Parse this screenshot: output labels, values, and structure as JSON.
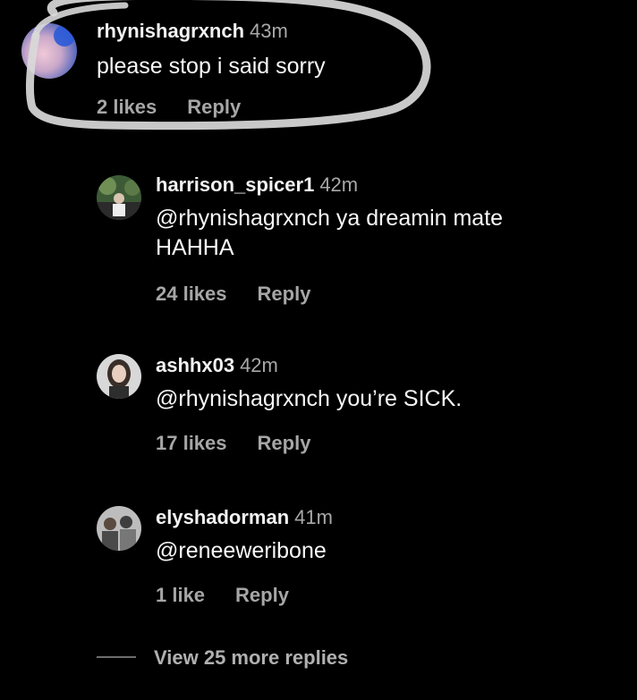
{
  "comments": [
    {
      "username": "rhynishagrxnch",
      "time": "43m",
      "text": "please stop i said sorry",
      "likes": "2 likes",
      "reply": "Reply",
      "avatar_icon": "avatar-blue-photo"
    },
    {
      "username": "harrison_spicer1",
      "time": "42m",
      "text": "@rhynishagrxnch ya dreamin mate\nHAHHA",
      "likes": "24 likes",
      "reply": "Reply",
      "avatar_icon": "avatar-green-photo"
    },
    {
      "username": "ashhx03",
      "time": "42m",
      "text": "@rhynishagrxnch you’re SICK.",
      "likes": "17 likes",
      "reply": "Reply",
      "avatar_icon": "avatar-portrait-photo"
    },
    {
      "username": "elyshadorman",
      "time": "41m",
      "text": "@reneeweribone",
      "likes": "1 like",
      "reply": "Reply",
      "avatar_icon": "avatar-group-photo"
    }
  ],
  "view_more": "View 25 more replies",
  "colors": {
    "background": "#000000",
    "scribble": "#d9d9d9",
    "secondary_text": "#a6a6a6"
  }
}
